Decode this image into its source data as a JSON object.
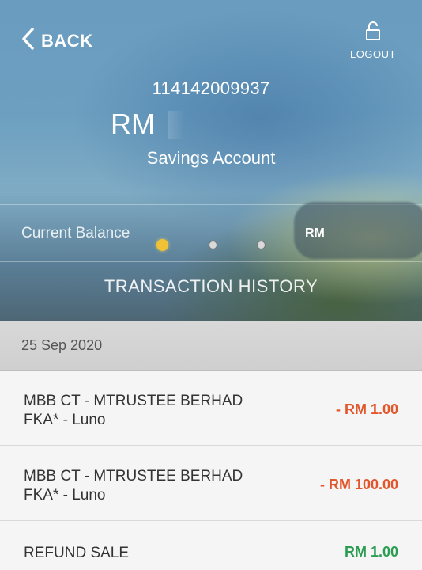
{
  "header": {
    "back_label": "BACK",
    "logout_label": "LOGOUT"
  },
  "account": {
    "number": "114142009937",
    "balance_display": "RM",
    "type": "Savings Account",
    "current_balance_label": "Current Balance",
    "current_balance_value": "RM"
  },
  "carousel": {
    "pages": 3,
    "active_index": 0
  },
  "transaction_history_title": "TRANSACTION HISTORY",
  "date_group": "25 Sep 2020",
  "transactions": [
    {
      "line1": "MBB CT - MTRUSTEE BERHAD",
      "line2": "FKA* - Luno",
      "amount": "- RM 1.00",
      "kind": "debit"
    },
    {
      "line1": "MBB CT - MTRUSTEE BERHAD",
      "line2": "FKA* - Luno",
      "amount": "- RM 100.00",
      "kind": "debit"
    },
    {
      "line1": "REFUND SALE",
      "line2": "",
      "amount": "RM 1.00",
      "kind": "credit"
    }
  ],
  "colors": {
    "debit": "#e2562b",
    "credit": "#2a9d52",
    "active_dot": "#f1c233"
  },
  "icons": {
    "back": "chevron-left-icon",
    "logout": "unlock-icon"
  }
}
